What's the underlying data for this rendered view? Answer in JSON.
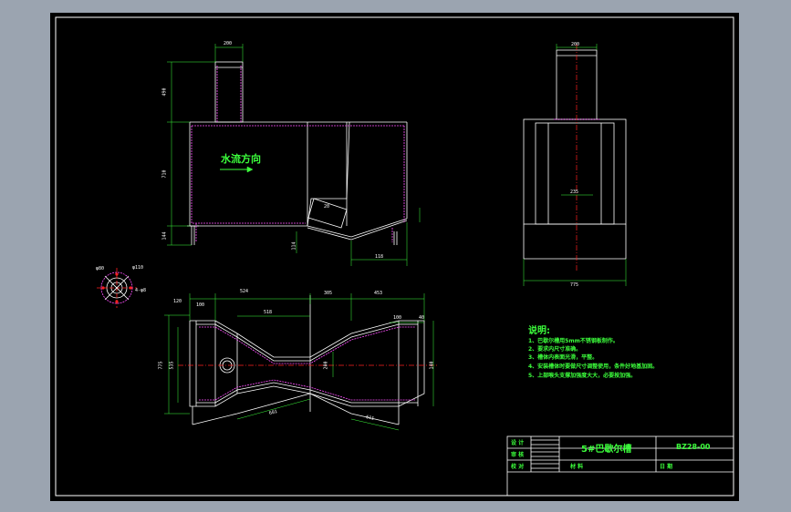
{
  "colors": {
    "background": "#9ba4b0",
    "sheet": "#000000",
    "line": "#ffffff",
    "dim_line": "#3cff3c",
    "hidden": "#ff4fff",
    "center": "#ff2020",
    "text": "#3cff3c"
  },
  "front_view": {
    "flow_label": "水流方向",
    "dims": [
      "200",
      "490",
      "710",
      "144",
      "114",
      "118",
      "20"
    ]
  },
  "side_view": {
    "dims": [
      "200",
      "235",
      "775"
    ]
  },
  "flange": {
    "dims": [
      "φ80",
      "φ110",
      "4-φ8"
    ]
  },
  "plan_view": {
    "dims": [
      "120",
      "100",
      "524",
      "305",
      "453",
      "100",
      "40",
      "518",
      "775",
      "535",
      "200",
      "601",
      "611",
      "140"
    ]
  },
  "notes": {
    "title": "说明:",
    "items": [
      "1、巴歇尔槽用5mm不锈钢板制作。",
      "2、要求内尺寸准确。",
      "3、槽体内表面光滑，平整。",
      "4、安装槽体时要做尺寸调整使用，条件好地基加固。",
      "5、上部喉头支撑加强度大大，必要按加强。"
    ]
  },
  "title_block": {
    "row1": [
      "设 计",
      "审 核"
    ],
    "row2": "工 艺",
    "row3": "校 对",
    "name": "5#巴歇尔槽",
    "drawing_no": "BZ28-00",
    "material_label": "材 料",
    "date_label": "日 期"
  }
}
